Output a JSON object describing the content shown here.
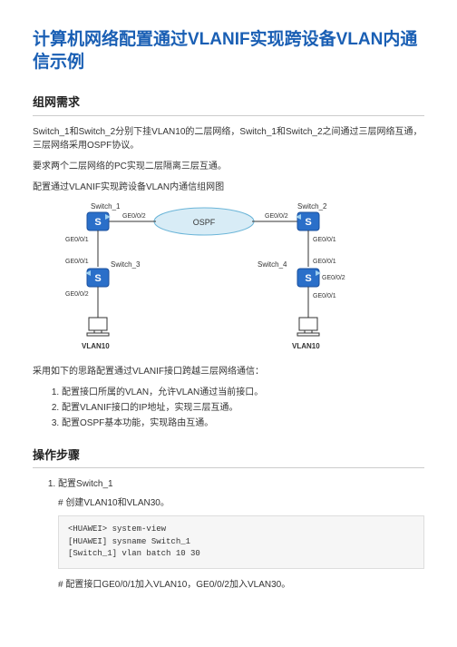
{
  "title": "计算机网络配置通过VLANIF实现跨设备VLAN内通信示例",
  "sections": {
    "req": {
      "heading": "组网需求",
      "p1": "Switch_1和Switch_2分别下挂VLAN10的二层网络，Switch_1和Switch_2之间通过三层网络互通，三层网络采用OSPF协议。",
      "p2": "要求两个二层网络的PC实现二层隔离三层互通。",
      "p3": "配置通过VLANIF实现跨设备VLAN内通信组网图",
      "p4": "采用如下的思路配置通过VLANIF接口跨越三层网络通信：",
      "steps": [
        "配置接口所属的VLAN，允许VLAN通过当前接口。",
        "配置VLANIF接口的IP地址，实现三层互通。",
        "配置OSPF基本功能，实现路由互通。"
      ]
    },
    "ops": {
      "heading": "操作步骤",
      "step1": {
        "label": "配置Switch_1",
        "sub1": "# 创建VLAN10和VLAN30。",
        "code1": "<HUAWEI> system-view\n[HUAWEI] sysname Switch_1\n[Switch_1] vlan batch 10 30",
        "sub2": "# 配置接口GE0/0/1加入VLAN10，GE0/0/2加入VLAN30。"
      }
    }
  },
  "diagram": {
    "switch1": "Switch_1",
    "switch2": "Switch_2",
    "switch3": "Switch_3",
    "switch4": "Switch_4",
    "ospf": "OSPF",
    "ge001": "GE0/0/1",
    "ge002": "GE0/0/2",
    "vlan10": "VLAN10"
  },
  "chart_data": {
    "type": "diagram",
    "description": "Network topology showing cross-device VLAN communication via VLANIF",
    "nodes": [
      {
        "id": "Switch_1",
        "type": "L3-switch"
      },
      {
        "id": "Switch_2",
        "type": "L3-switch"
      },
      {
        "id": "Switch_3",
        "type": "L2-switch"
      },
      {
        "id": "Switch_4",
        "type": "L2-switch"
      },
      {
        "id": "OSPF-cloud",
        "type": "network-cloud",
        "label": "OSPF"
      },
      {
        "id": "PC1",
        "type": "host",
        "vlan": "VLAN10"
      },
      {
        "id": "PC2",
        "type": "host",
        "vlan": "VLAN10"
      }
    ],
    "links": [
      {
        "from": "Switch_1",
        "port_from": "GE0/0/2",
        "to": "OSPF-cloud"
      },
      {
        "from": "Switch_2",
        "port_from": "GE0/0/2",
        "to": "OSPF-cloud"
      },
      {
        "from": "Switch_1",
        "port_from": "GE0/0/1",
        "to": "Switch_3",
        "port_to": "GE0/0/1"
      },
      {
        "from": "Switch_2",
        "port_from": "GE0/0/1",
        "to": "Switch_4",
        "port_to": "GE0/0/1"
      },
      {
        "from": "Switch_3",
        "port_from": "GE0/0/2",
        "to": "PC1"
      },
      {
        "from": "Switch_4",
        "port_from": "GE0/0/2",
        "to": "PC2"
      }
    ]
  }
}
